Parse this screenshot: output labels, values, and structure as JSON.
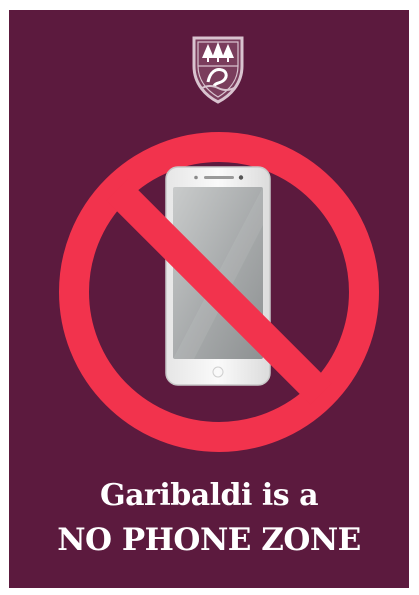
{
  "headline": {
    "line1": "Garibaldi is a",
    "line2": "NO PHONE ZONE"
  },
  "icons": {
    "crest": "school-crest-icon",
    "prohibition": "no-symbol-icon",
    "phone": "smartphone-icon"
  },
  "colors": {
    "background": "#5c1a3e",
    "prohibition": "#f2334d",
    "text": "#ffffff"
  }
}
